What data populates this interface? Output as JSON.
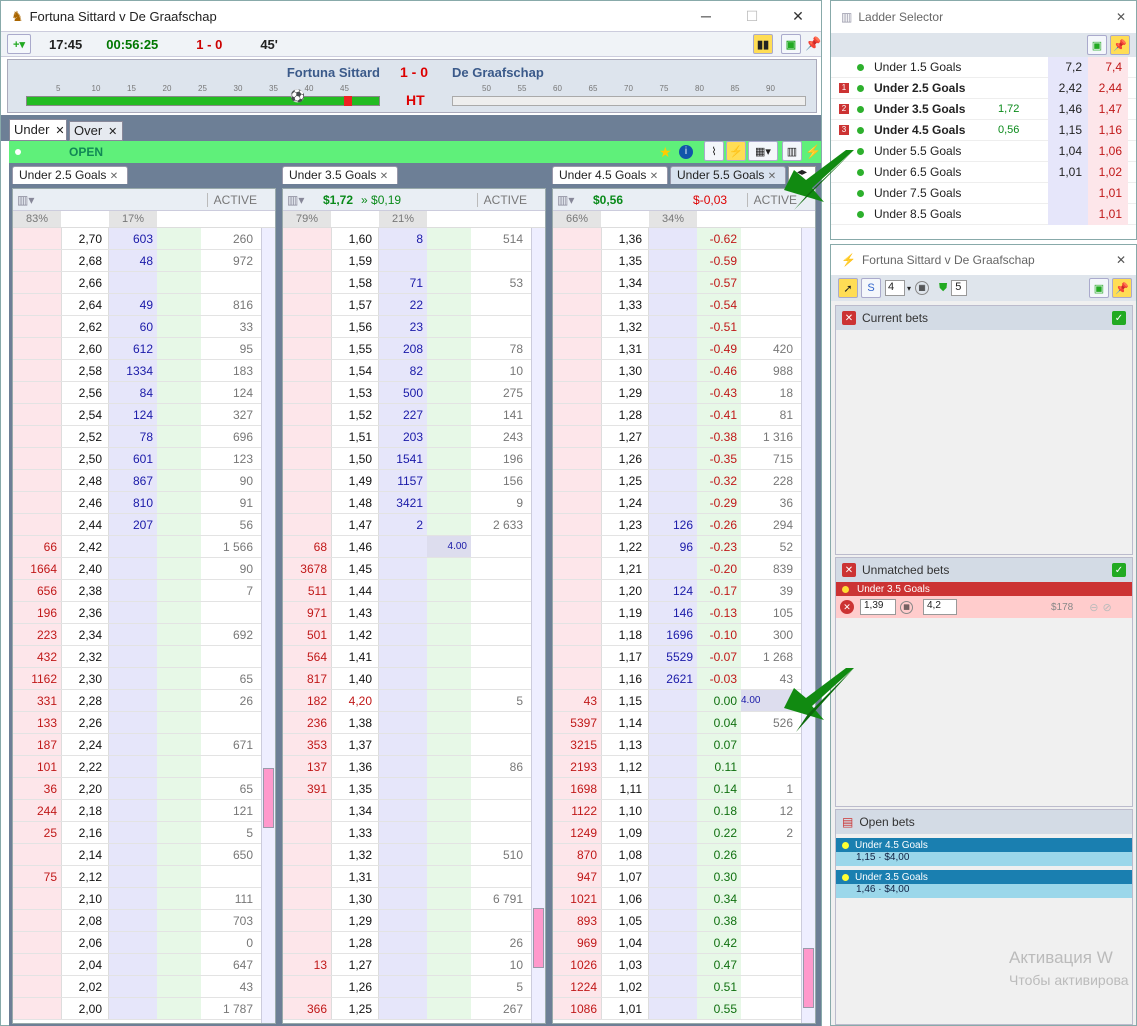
{
  "main": {
    "title": "Fortuna Sittard v De Graafschap",
    "clock": "17:45",
    "elapsed": "00:56:25",
    "score": "1 - 0",
    "minute": "45'",
    "home": "Fortuna Sittard",
    "away": "De Graafschap",
    "status": "HT",
    "timeline1": [
      "5",
      "10",
      "15",
      "20",
      "25",
      "30",
      "35",
      "40",
      "45"
    ],
    "timeline2": [
      "50",
      "55",
      "60",
      "65",
      "70",
      "75",
      "80",
      "85",
      "90"
    ],
    "tab_under": "Under",
    "tab_over": "Over",
    "market_status": "OPEN"
  },
  "ladders": [
    {
      "tab": "Under 2.5 Goals",
      "pl1": "",
      "pl2": "",
      "active": "ACTIVE",
      "pct_back": "83%",
      "pct_lay": "17%",
      "rows": [
        [
          "",
          "2,70",
          "603",
          "",
          "260"
        ],
        [
          "",
          "2,68",
          "48",
          "",
          "972"
        ],
        [
          "",
          "2,66",
          "",
          "",
          ""
        ],
        [
          "",
          "2,64",
          "49",
          "",
          "816"
        ],
        [
          "",
          "2,62",
          "60",
          "",
          "33"
        ],
        [
          "",
          "2,60",
          "612",
          "",
          "95"
        ],
        [
          "",
          "2,58",
          "1334",
          "",
          "183"
        ],
        [
          "",
          "2,56",
          "84",
          "",
          "124"
        ],
        [
          "",
          "2,54",
          "124",
          "",
          "327"
        ],
        [
          "",
          "2,52",
          "78",
          "",
          "696"
        ],
        [
          "",
          "2,50",
          "601",
          "",
          "123"
        ],
        [
          "",
          "2,48",
          "867",
          "",
          "90"
        ],
        [
          "",
          "2,46",
          "810",
          "",
          "91"
        ],
        [
          "",
          "2,44",
          "207",
          "",
          "56"
        ],
        [
          "66",
          "2,42",
          "",
          "",
          "1 566"
        ],
        [
          "1664",
          "2,40",
          "",
          "",
          "90"
        ],
        [
          "656",
          "2,38",
          "",
          "",
          "7"
        ],
        [
          "196",
          "2,36",
          "",
          "",
          ""
        ],
        [
          "223",
          "2,34",
          "",
          "",
          "692"
        ],
        [
          "432",
          "2,32",
          "",
          "",
          ""
        ],
        [
          "1162",
          "2,30",
          "",
          "",
          "65"
        ],
        [
          "331",
          "2,28",
          "",
          "",
          "26"
        ],
        [
          "133",
          "2,26",
          "",
          "",
          ""
        ],
        [
          "187",
          "2,24",
          "",
          "",
          "671"
        ],
        [
          "101",
          "2,22",
          "",
          "",
          ""
        ],
        [
          "36",
          "2,20",
          "",
          "",
          "65"
        ],
        [
          "244",
          "2,18",
          "",
          "",
          "121"
        ],
        [
          "25",
          "2,16",
          "",
          "",
          "5"
        ],
        [
          "",
          "2,14",
          "",
          "",
          "650"
        ],
        [
          "75",
          "2,12",
          "",
          "",
          ""
        ],
        [
          "",
          "2,10",
          "",
          "",
          "111"
        ],
        [
          "",
          "2,08",
          "",
          "",
          "703"
        ],
        [
          "",
          "2,06",
          "",
          "",
          "0"
        ],
        [
          "",
          "2,04",
          "",
          "",
          "647"
        ],
        [
          "",
          "2,02",
          "",
          "",
          "43"
        ],
        [
          "",
          "2,00",
          "",
          "",
          "1 787"
        ]
      ]
    },
    {
      "tab": "Under 3.5 Goals",
      "pl1": "$1,72",
      "pl2": "» $0,19",
      "active": "ACTIVE",
      "pct_back": "79%",
      "pct_lay": "21%",
      "rows": [
        [
          "",
          "1,60",
          "8",
          "",
          "514"
        ],
        [
          "",
          "1,59",
          "",
          "",
          ""
        ],
        [
          "",
          "1,58",
          "71",
          "",
          "53"
        ],
        [
          "",
          "1,57",
          "22",
          "",
          ""
        ],
        [
          "",
          "1,56",
          "23",
          "",
          ""
        ],
        [
          "",
          "1,55",
          "208",
          "",
          "78"
        ],
        [
          "",
          "1,54",
          "82",
          "",
          "10"
        ],
        [
          "",
          "1,53",
          "500",
          "",
          "275"
        ],
        [
          "",
          "1,52",
          "227",
          "",
          "141"
        ],
        [
          "",
          "1,51",
          "203",
          "",
          "243"
        ],
        [
          "",
          "1,50",
          "1541",
          "",
          "196"
        ],
        [
          "",
          "1,49",
          "1157",
          "",
          "156"
        ],
        [
          "",
          "1,48",
          "3421",
          "",
          "9"
        ],
        [
          "",
          "1,47",
          "2",
          "",
          "2 633"
        ],
        [
          "68",
          "1,46",
          "",
          "4.00",
          ""
        ],
        [
          "3678",
          "1,45",
          "",
          "",
          ""
        ],
        [
          "511",
          "1,44",
          "",
          "",
          ""
        ],
        [
          "971",
          "1,43",
          "",
          "",
          ""
        ],
        [
          "501",
          "1,42",
          "",
          "",
          ""
        ],
        [
          "564",
          "1,41",
          "",
          "",
          ""
        ],
        [
          "817",
          "1,40",
          "",
          "",
          ""
        ],
        [
          "182",
          "4,20",
          "",
          "",
          "5"
        ],
        [
          "236",
          "1,38",
          "",
          "",
          ""
        ],
        [
          "353",
          "1,37",
          "",
          "",
          ""
        ],
        [
          "137",
          "1,36",
          "",
          "",
          "86"
        ],
        [
          "391",
          "1,35",
          "",
          "",
          ""
        ],
        [
          "",
          "1,34",
          "",
          "",
          ""
        ],
        [
          "",
          "1,33",
          "",
          "",
          ""
        ],
        [
          "",
          "1,32",
          "",
          "",
          "510"
        ],
        [
          "",
          "1,31",
          "",
          "",
          ""
        ],
        [
          "",
          "1,30",
          "",
          "",
          "6 791"
        ],
        [
          "",
          "1,29",
          "",
          "",
          ""
        ],
        [
          "",
          "1,28",
          "",
          "",
          "26"
        ],
        [
          "13",
          "1,27",
          "",
          "",
          "10"
        ],
        [
          "",
          "1,26",
          "",
          "",
          "5"
        ],
        [
          "366",
          "1,25",
          "",
          "",
          "267"
        ]
      ]
    },
    {
      "tab": "Under 4.5 Goals",
      "tab2": "Under 5.5 Goals",
      "pl1": "$0,56",
      "pl2": "$-0,03",
      "active": "ACTIVE",
      "pct_back": "66%",
      "pct_lay": "34%",
      "rows": [
        [
          "",
          "1,36",
          "",
          "-0.62",
          ""
        ],
        [
          "",
          "1,35",
          "",
          "-0.59",
          ""
        ],
        [
          "",
          "1,34",
          "",
          "-0.57",
          ""
        ],
        [
          "",
          "1,33",
          "",
          "-0.54",
          ""
        ],
        [
          "",
          "1,32",
          "",
          "-0.51",
          ""
        ],
        [
          "",
          "1,31",
          "",
          "-0.49",
          "420"
        ],
        [
          "",
          "1,30",
          "",
          "-0.46",
          "988"
        ],
        [
          "",
          "1,29",
          "",
          "-0.43",
          "18"
        ],
        [
          "",
          "1,28",
          "",
          "-0.41",
          "81"
        ],
        [
          "",
          "1,27",
          "",
          "-0.38",
          "1 316"
        ],
        [
          "",
          "1,26",
          "",
          "-0.35",
          "715"
        ],
        [
          "",
          "1,25",
          "",
          "-0.32",
          "228"
        ],
        [
          "",
          "1,24",
          "",
          "-0.29",
          "36"
        ],
        [
          "",
          "1,23",
          "126",
          "-0.26",
          "294"
        ],
        [
          "",
          "1,22",
          "96",
          "-0.23",
          "52"
        ],
        [
          "",
          "1,21",
          "",
          "-0.20",
          "839"
        ],
        [
          "",
          "1,20",
          "124",
          "-0.17",
          "39"
        ],
        [
          "",
          "1,19",
          "146",
          "-0.13",
          "105"
        ],
        [
          "",
          "1,18",
          "1696",
          "-0.10",
          "300"
        ],
        [
          "",
          "1,17",
          "5529",
          "-0.07",
          "1 268"
        ],
        [
          "",
          "1,16",
          "2621",
          "-0.03",
          "43"
        ],
        [
          "43",
          "1,15",
          "",
          "0.00",
          "4.00"
        ],
        [
          "5397",
          "1,14",
          "",
          "0.04",
          "526"
        ],
        [
          "3215",
          "1,13",
          "",
          "0.07",
          ""
        ],
        [
          "2193",
          "1,12",
          "",
          "0.11",
          ""
        ],
        [
          "1698",
          "1,11",
          "",
          "0.14",
          "1"
        ],
        [
          "1122",
          "1,10",
          "",
          "0.18",
          "12"
        ],
        [
          "1249",
          "1,09",
          "",
          "0.22",
          "2"
        ],
        [
          "870",
          "1,08",
          "",
          "0.26",
          ""
        ],
        [
          "947",
          "1,07",
          "",
          "0.30",
          ""
        ],
        [
          "1021",
          "1,06",
          "",
          "0.34",
          ""
        ],
        [
          "893",
          "1,05",
          "",
          "0.38",
          ""
        ],
        [
          "969",
          "1,04",
          "",
          "0.42",
          ""
        ],
        [
          "1026",
          "1,03",
          "",
          "0.47",
          ""
        ],
        [
          "1224",
          "1,02",
          "",
          "0.51",
          ""
        ],
        [
          "1086",
          "1,01",
          "",
          "0.55",
          ""
        ]
      ]
    }
  ],
  "selector": {
    "title": "Ladder Selector",
    "items": [
      {
        "badge": "",
        "name": "Under 1.5 Goals",
        "bold": false,
        "pl": "",
        "back": "7,2",
        "lay": "7,4"
      },
      {
        "badge": "1",
        "name": "Under 2.5 Goals",
        "bold": true,
        "pl": "",
        "back": "2,42",
        "lay": "2,44"
      },
      {
        "badge": "2",
        "name": "Under 3.5 Goals",
        "bold": true,
        "pl": "1,72",
        "back": "1,46",
        "lay": "1,47"
      },
      {
        "badge": "3",
        "name": "Under 4.5 Goals",
        "bold": true,
        "pl": "0,56",
        "back": "1,15",
        "lay": "1,16"
      },
      {
        "badge": "",
        "name": "Under 5.5 Goals",
        "bold": false,
        "pl": "",
        "back": "1,04",
        "lay": "1,06"
      },
      {
        "badge": "",
        "name": "Under 6.5 Goals",
        "bold": false,
        "pl": "",
        "back": "1,01",
        "lay": "1,02"
      },
      {
        "badge": "",
        "name": "Under 7.5 Goals",
        "bold": false,
        "pl": "",
        "back": "",
        "lay": "1,01"
      },
      {
        "badge": "",
        "name": "Under 8.5 Goals",
        "bold": false,
        "pl": "",
        "back": "",
        "lay": "1,01"
      }
    ]
  },
  "bets": {
    "title": "Fortuna Sittard v De Graafschap",
    "stake1": "4",
    "stake2": "5",
    "current": "Current bets",
    "unmatched": "Unmatched bets",
    "open": "Open bets",
    "unmatched_market": "Under 3.5 Goals",
    "unmatched_odds": "1,39",
    "unmatched_stake": "4,2",
    "unmatched_amount": "$178",
    "open_items": [
      {
        "market": "Under 4.5 Goals",
        "detail": "1,15 · $4,00"
      },
      {
        "market": "Under 3.5 Goals",
        "detail": "1,46 · $4,00"
      }
    ]
  },
  "watermark": {
    "line1": "Активация W",
    "line2": "Чтобы активирова"
  }
}
